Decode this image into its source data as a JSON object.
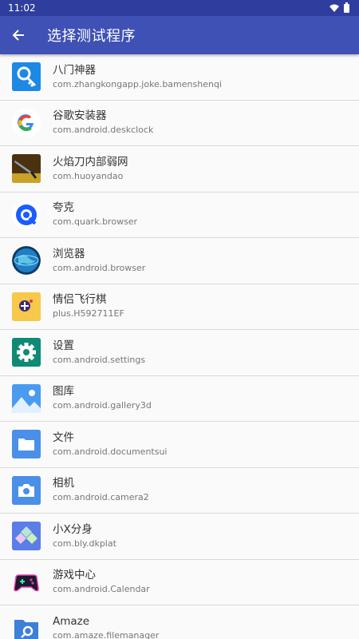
{
  "status_bar": {
    "time": "11:02"
  },
  "toolbar": {
    "title": "选择测试程序",
    "back_icon": "arrow-left-icon"
  },
  "apps": [
    {
      "name": "八门神器",
      "package": "com.zhangkongapp.joke.bamenshenqi",
      "icon": "bamen-icon"
    },
    {
      "name": "谷歌安装器",
      "package": "com.android.deskclock",
      "icon": "google-icon"
    },
    {
      "name": "火焰刀内部弱网",
      "package": "com.huoyandao",
      "icon": "flame-blade-icon"
    },
    {
      "name": "夸克",
      "package": "com.quark.browser",
      "icon": "quark-icon"
    },
    {
      "name": "浏览器",
      "package": "com.android.browser",
      "icon": "globe-icon"
    },
    {
      "name": "情侣飞行棋",
      "package": "plus.H592711EF",
      "icon": "flight-chess-icon"
    },
    {
      "name": "设置",
      "package": "com.android.settings",
      "icon": "gear-icon"
    },
    {
      "name": "图库",
      "package": "com.android.gallery3d",
      "icon": "gallery-icon"
    },
    {
      "name": "文件",
      "package": "com.android.documentsui",
      "icon": "folder-icon"
    },
    {
      "name": "相机",
      "package": "com.android.camera2",
      "icon": "camera-icon"
    },
    {
      "name": "小X分身",
      "package": "com.bly.dkplat",
      "icon": "x-clone-icon"
    },
    {
      "name": "游戏中心",
      "package": "com.android.Calendar",
      "icon": "game-center-icon"
    },
    {
      "name": "Amaze",
      "package": "com.amaze.filemanager",
      "icon": "amaze-icon"
    }
  ]
}
